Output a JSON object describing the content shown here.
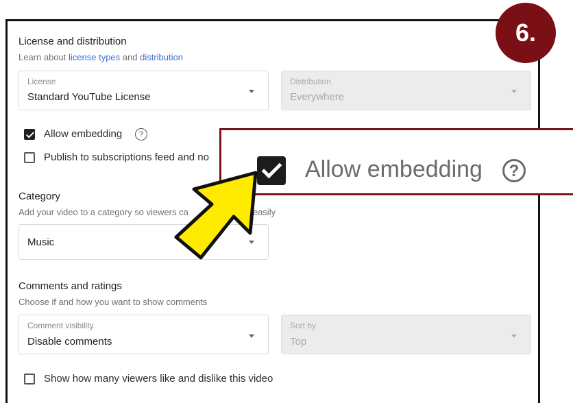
{
  "license_section": {
    "title": "License and distribution",
    "subtitle_prefix": "Learn about ",
    "link_license_types": "license types",
    "subtitle_and": " and ",
    "link_distribution": "distribution",
    "license": {
      "label": "License",
      "value": "Standard YouTube License"
    },
    "distribution": {
      "label": "Distribution",
      "value": "Everywhere"
    },
    "allow_embedding": {
      "label": "Allow embedding",
      "checked": true
    },
    "publish_feed": {
      "label": "Publish to subscriptions feed and no",
      "checked": false
    }
  },
  "category_section": {
    "title": "Category",
    "subtitle_left": "Add your video to a category so viewers ca",
    "subtitle_right": "e easily",
    "value": "Music"
  },
  "comments_section": {
    "title": "Comments and ratings",
    "subtitle": "Choose if and how you want to show comments",
    "visibility": {
      "label": "Comment visibility",
      "value": "Disable comments"
    },
    "sort_by": {
      "label": "Sort by",
      "value": "Top"
    },
    "show_likes": {
      "label": "Show how many viewers like and dislike this video",
      "checked": false
    }
  },
  "zoom_callout": {
    "label": "Allow embedding",
    "help_glyph": "?"
  },
  "step_badge": "6.",
  "colors": {
    "badge": "#7a1015",
    "arrow": "#ffeb00",
    "link": "#3a6fd0",
    "callout_border": "#7a1418"
  },
  "icons": [
    "question-circle-icon",
    "chevron-down-icon",
    "checkbox-checked-icon",
    "checkbox-empty-icon",
    "arrow-pointer-icon"
  ]
}
